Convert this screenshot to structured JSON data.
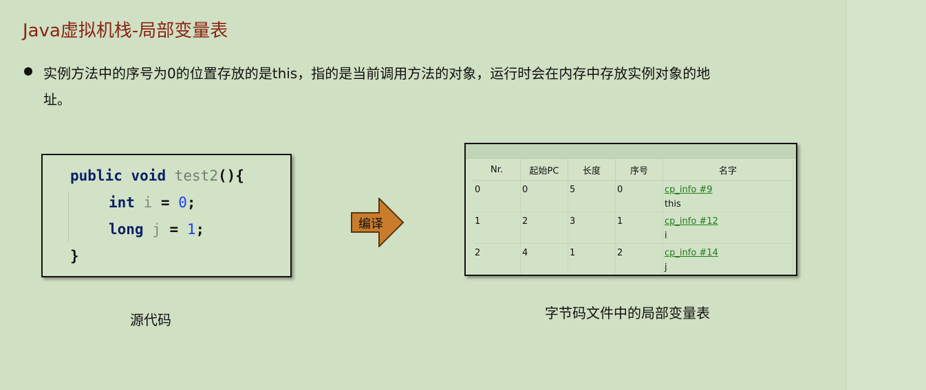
{
  "slide": {
    "title": "Java虚拟机栈-局部变量表",
    "bullet": "实例方法中的序号为0的位置存放的是this，指的是当前调用方法的对象，运行时会在内存中存放实例对象的地址。"
  },
  "code": {
    "line1": {
      "kw1": "public",
      "kw2": "void",
      "fn": "test2",
      "tail": "(){"
    },
    "line2": {
      "kw": "int",
      "var": "i",
      "eq": "=",
      "num": "0",
      "semi": ";"
    },
    "line3": {
      "kw": "long",
      "var": "j",
      "eq": "=",
      "num": "1",
      "semi": ";"
    },
    "line4": "}"
  },
  "arrow": {
    "label": "编译",
    "fill": "#c97d2c"
  },
  "bytecode": {
    "headers": [
      "Nr.",
      "起始PC",
      "长度",
      "序号",
      "名字"
    ],
    "rows": [
      {
        "nr": "0",
        "pc": "0",
        "len": "5",
        "idx": "0",
        "link": "cp_info #9",
        "name": "this"
      },
      {
        "nr": "1",
        "pc": "2",
        "len": "3",
        "idx": "1",
        "link": "cp_info #12",
        "name": "i"
      },
      {
        "nr": "2",
        "pc": "4",
        "len": "1",
        "idx": "2",
        "link": "cp_info #14",
        "name": "j"
      }
    ]
  },
  "captions": {
    "left": "源代码",
    "right": "字节码文件中的局部变量表"
  },
  "colors": {
    "title": "#8b2314",
    "background": "#cfe0c3",
    "link": "#1f7a1f"
  }
}
